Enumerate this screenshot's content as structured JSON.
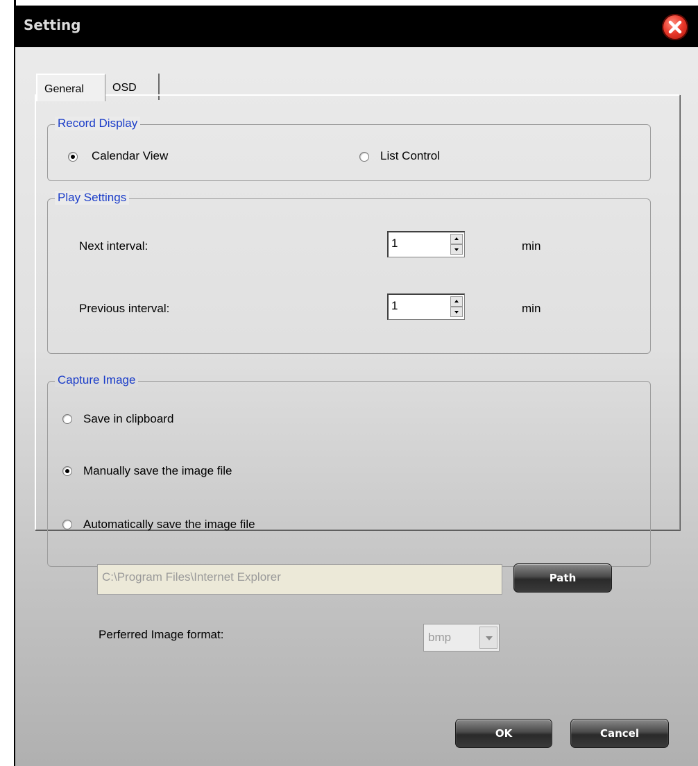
{
  "window": {
    "title": "Setting"
  },
  "tabs": [
    {
      "label": "General",
      "active": true
    },
    {
      "label": "OSD",
      "active": false
    }
  ],
  "record_display": {
    "label": "Record Display",
    "options": [
      {
        "label": "Calendar View",
        "checked": true
      },
      {
        "label": "List Control",
        "checked": false
      }
    ]
  },
  "play_settings": {
    "label": "Play Settings",
    "next": {
      "label": "Next interval:",
      "value": "1",
      "unit": "min"
    },
    "previous": {
      "label": "Previous interval:",
      "value": "1",
      "unit": "min"
    }
  },
  "capture_image": {
    "label": "Capture Image",
    "options": [
      {
        "label": "Save in clipboard",
        "checked": false
      },
      {
        "label": "Manually save the image file",
        "checked": true
      },
      {
        "label": "Automatically save the image file",
        "checked": false
      }
    ],
    "path_value": "C:\\Program Files\\Internet Explorer",
    "path_button": "Path",
    "format_label": "Perferred Image format:",
    "format_value": "bmp"
  },
  "footer": {
    "ok": "OK",
    "cancel": "Cancel"
  },
  "colors": {
    "group_label": "#1a3cc8",
    "titlebar": "#000000",
    "close": "#e8382a"
  }
}
